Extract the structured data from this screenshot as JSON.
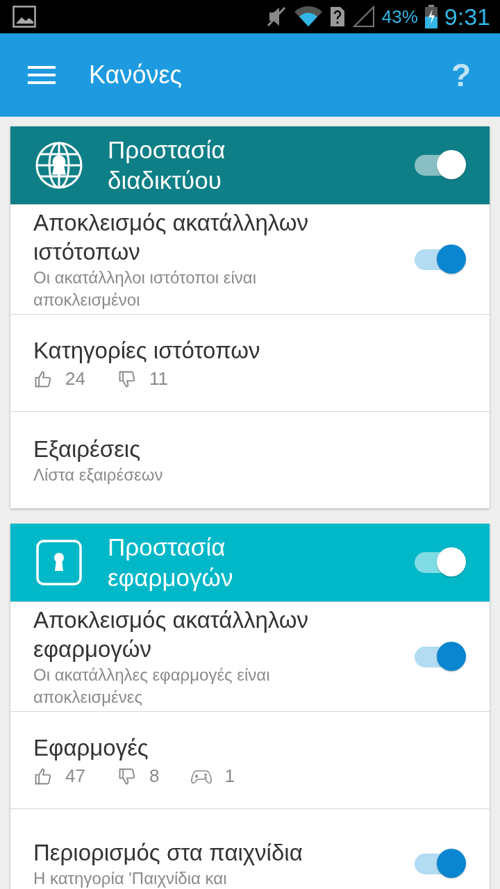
{
  "status_bar": {
    "battery_text": "43%",
    "time": "9:31"
  },
  "app_bar": {
    "title": "Κανόνες",
    "help": "?"
  },
  "sections": [
    {
      "title": "Προστασία διαδικτύου",
      "kind": "globe",
      "color": "#0f7f87",
      "on": true,
      "items": [
        {
          "kind": "switch",
          "title": "Αποκλεισμός ακατάλληλων ιστότοπων",
          "subtitle": "Οι ακατάλληλοι ιστότοποι είναι αποκλεισμένοι",
          "on": true
        },
        {
          "kind": "counts",
          "title": "Κατηγορίες ιστότοπων",
          "counts": [
            {
              "kind": "like",
              "value": "24"
            },
            {
              "kind": "dislike",
              "value": "11"
            }
          ]
        },
        {
          "kind": "link",
          "title": "Εξαιρέσεις",
          "subtitle": "Λίστα εξαιρέσεων"
        }
      ]
    },
    {
      "title": "Προστασία εφαρμογών",
      "kind": "lock",
      "color": "#00b8c8",
      "on": true,
      "items": [
        {
          "kind": "switch",
          "title": "Αποκλεισμός ακατάλληλων εφαρμογών",
          "subtitle": "Οι ακατάλληλες εφαρμογές είναι αποκλεισμένες",
          "on": true
        },
        {
          "kind": "counts",
          "title": "Εφαρμογές",
          "counts": [
            {
              "kind": "like",
              "value": "47"
            },
            {
              "kind": "dislike",
              "value": "8"
            },
            {
              "kind": "games",
              "value": "1"
            }
          ]
        },
        {
          "kind": "switch",
          "title": "Περιορισμός στα παιχνίδια",
          "subtitle": "Η κατηγορία 'Παιχνίδια και",
          "on": true
        }
      ]
    }
  ]
}
